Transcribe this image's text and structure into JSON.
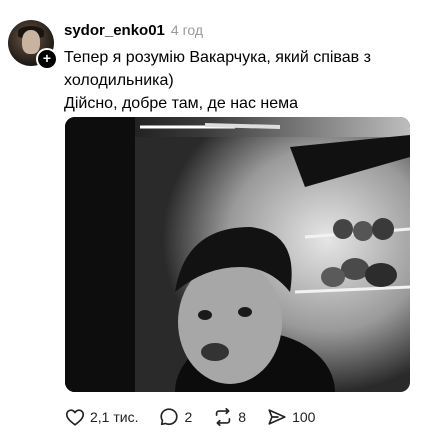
{
  "post": {
    "author": {
      "username": "sydor_enko01",
      "avatar_badge": "+"
    },
    "time": "4 год",
    "text_lines": [
      "Тепер я розумію Вакарчука, який співав з холодильника)",
      "Дійсно, добре там, де нас нема"
    ],
    "media": {
      "type": "image",
      "style": "black-and-white"
    },
    "actions": {
      "likes": {
        "icon": "heart-icon",
        "count": "2,1 тис."
      },
      "replies": {
        "icon": "comment-icon",
        "count": "2"
      },
      "reposts": {
        "icon": "repost-icon",
        "count": "8"
      },
      "shares": {
        "icon": "share-icon",
        "count": "100"
      }
    }
  }
}
